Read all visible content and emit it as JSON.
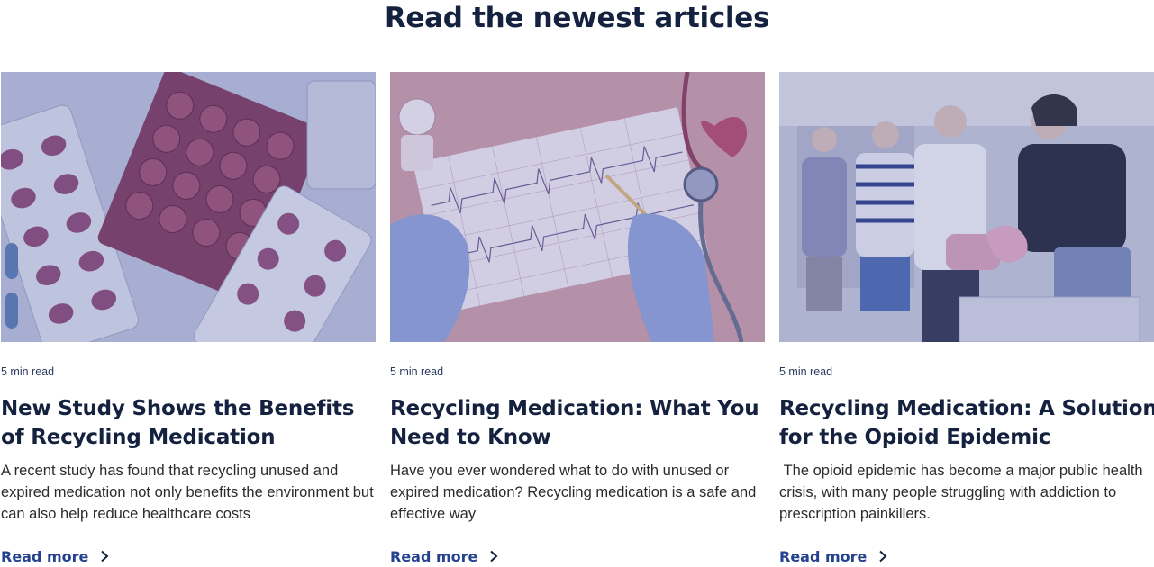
{
  "section": {
    "title": "Read the newest articles"
  },
  "articles": [
    {
      "read_time": "5 min read",
      "title_line1": "New Study Shows the Benefits",
      "title_line2": "of Recycling Medication",
      "excerpt": "A recent study has found that recycling unused and expired medication not only benefits the environment but can also help reduce healthcare costs",
      "cta": "Read more",
      "image_icon": "pill-blister-packs-image"
    },
    {
      "read_time": "5 min read",
      "title_line1": "Recycling Medication: What You",
      "title_line2": "Need to Know",
      "excerpt": "Have you ever wondered what to do with unused or expired medication? Recycling medication is a safe and effective way",
      "cta": "Read more",
      "image_icon": "ecg-printout-stethoscope-image"
    },
    {
      "read_time": "5 min read",
      "title_line1": "Recycling Medication: A Solution",
      "title_line2": "for the Opioid Epidemic",
      "excerpt": " The opioid epidemic has become a major public health crisis, with many people struggling with addiction to prescription painkillers.",
      "cta": "Read more",
      "image_icon": "people-disposing-medication-image"
    }
  ],
  "colors": {
    "heading": "#14213f",
    "link": "#24428f",
    "image_tint": "#5a63b0"
  }
}
